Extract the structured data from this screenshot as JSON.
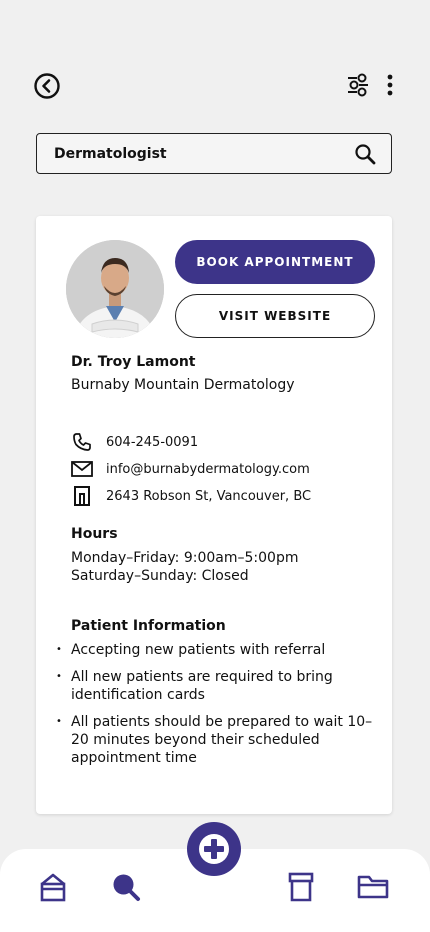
{
  "search": {
    "value": "Dermatologist"
  },
  "doctor": {
    "name": "Dr. Troy Lamont",
    "clinic": "Burnaby Mountain Dermatology"
  },
  "actions": {
    "book": "BOOK APPOINTMENT",
    "website": "VISIT WEBSITE"
  },
  "contact": {
    "phone": "604-245-0091",
    "email": "info@burnabydermatology.com",
    "address": "2643 Robson St, Vancouver, BC"
  },
  "hours": {
    "heading": "Hours",
    "weekdays": "Monday–Friday: 9:00am–5:00pm",
    "weekend": "Saturday–Sunday: Closed"
  },
  "patient_info": {
    "heading": "Patient Information",
    "items": [
      "Accepting new patients with referral",
      "All new patients are required to bring identification cards",
      "All patients should be prepared to wait 10–20 minutes beyond their scheduled appointment time"
    ]
  },
  "icons": {
    "back": "back-circle-icon",
    "filter": "filter-sliders-icon",
    "more": "kebab-menu-icon",
    "search": "search-icon",
    "phone": "phone-icon",
    "mail": "mail-icon",
    "building": "building-icon",
    "home": "home-icon",
    "nav_search": "search-icon",
    "add": "plus-icon",
    "archive": "archive-icon",
    "folder": "folder-icon"
  },
  "colors": {
    "accent": "#3d3489"
  }
}
